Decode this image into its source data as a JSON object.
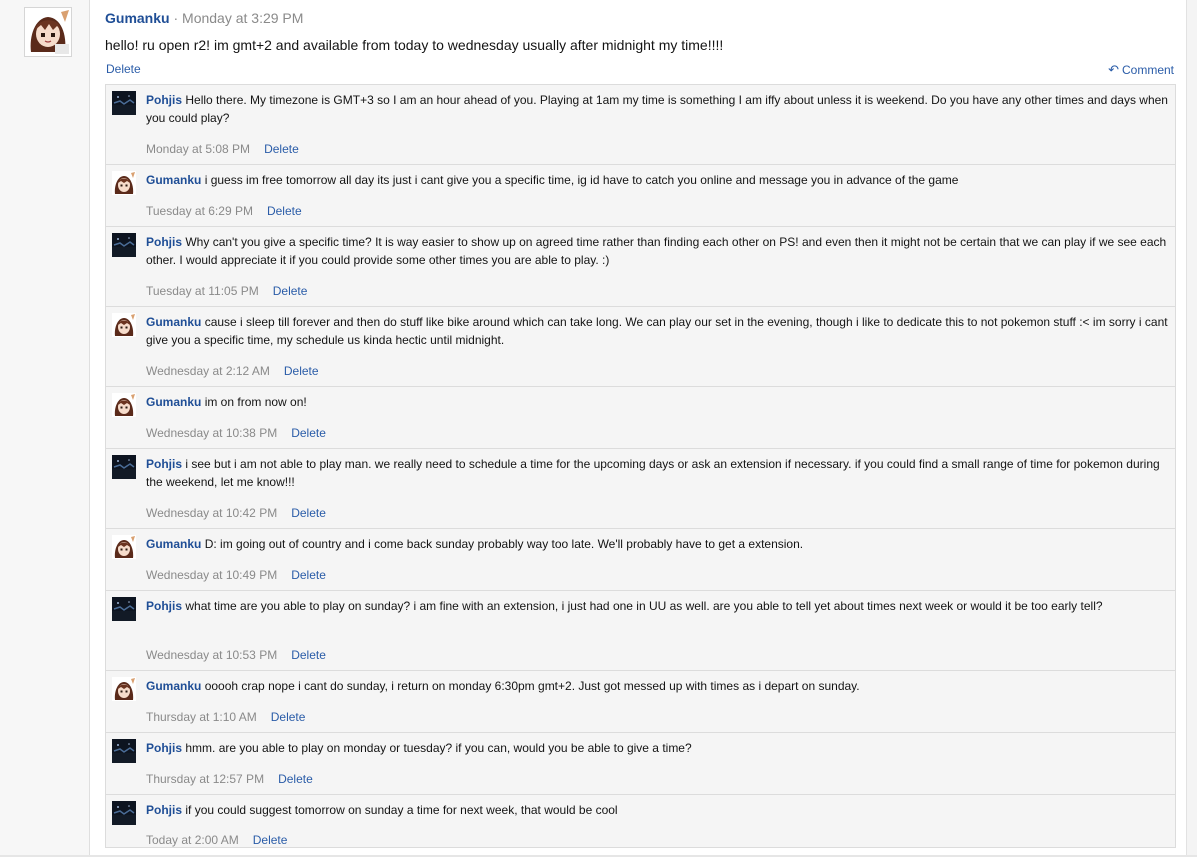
{
  "post": {
    "author": "Gumanku",
    "separator": "·",
    "time": "Monday at 3:29 PM",
    "body": "hello! ru open r2! im gmt+2 and available from today to wednesday usually after midnight my time!!!!",
    "delete_label": "Delete",
    "comment_label": "Comment"
  },
  "comments": [
    {
      "author": "Pohjis",
      "avatar": "pohjis-avatar",
      "text": "Hello there. My timezone is GMT+3 so I am an hour ahead of you. Playing at 1am my time is something I am iffy about unless it is weekend. Do you have any other times and days when you could play?",
      "time": "Monday at 5:08 PM",
      "delete": "Delete"
    },
    {
      "author": "Gumanku",
      "avatar": "gumanku-avatar",
      "text": "i guess im free tomorrow all day its just i cant give you a specific time, ig id have to catch you online and message you in advance of the game",
      "time": "Tuesday at 6:29 PM",
      "delete": "Delete"
    },
    {
      "author": "Pohjis",
      "avatar": "pohjis-avatar",
      "text": "Why can't you give a specific time? It is way easier to show up on agreed time rather than finding each other on PS! and even then it might not be certain that we can play if we see each other. I would appreciate it if you could provide some other times you are able to play. :)",
      "time": "Tuesday at 11:05 PM",
      "delete": "Delete"
    },
    {
      "author": "Gumanku",
      "avatar": "gumanku-avatar",
      "text": "cause i sleep till forever and then do stuff like bike around which can take long. We can play our set in the evening, though i like to dedicate this to not pokemon stuff :< im sorry i cant give you a specific time, my schedule us kinda hectic until midnight.",
      "time": "Wednesday at 2:12 AM",
      "delete": "Delete"
    },
    {
      "author": "Gumanku",
      "avatar": "gumanku-avatar",
      "text": "im on from now on!",
      "time": "Wednesday at 10:38 PM",
      "delete": "Delete"
    },
    {
      "author": "Pohjis",
      "avatar": "pohjis-avatar",
      "text": "i see but i am not able to play man. we really need to schedule a time for the upcoming days or ask an extension if necessary. if you could find a small range of time for pokemon during the weekend, let me know!!!",
      "time": "Wednesday at 10:42 PM",
      "delete": "Delete"
    },
    {
      "author": "Gumanku",
      "avatar": "gumanku-avatar",
      "text": "D: im going out of country and i come back sunday probably way too late. We'll probably have to get a extension.",
      "time": "Wednesday at 10:49 PM",
      "delete": "Delete"
    },
    {
      "author": "Pohjis",
      "avatar": "pohjis-avatar",
      "text": "what time are you able to play on sunday? i am fine with an extension, i just had one in UU as well. are you able to tell yet about times next week or would it be too early tell?",
      "time": "Wednesday at 10:53 PM",
      "delete": "Delete"
    },
    {
      "author": "Gumanku",
      "avatar": "gumanku-avatar",
      "text": "ooooh crap nope i cant do sunday, i return on monday 6:30pm gmt+2. Just got messed up with times as i depart on sunday.",
      "time": "Thursday at 1:10 AM",
      "delete": "Delete"
    },
    {
      "author": "Pohjis",
      "avatar": "pohjis-avatar",
      "text": "hmm. are you able to play on monday or tuesday? if you can, would you be able to give a time?",
      "time": "Thursday at 12:57 PM",
      "delete": "Delete"
    },
    {
      "author": "Pohjis",
      "avatar": "pohjis-avatar",
      "text": "if you could suggest tomorrow on sunday a time for next week, that would be cool",
      "time": "Today at 2:00 AM",
      "delete": "Delete"
    }
  ],
  "colors": {
    "link": "#2a5ca8",
    "username": "#1f4e96",
    "muted": "#8a8a8a",
    "comment_bg": "#f5f5f5"
  }
}
